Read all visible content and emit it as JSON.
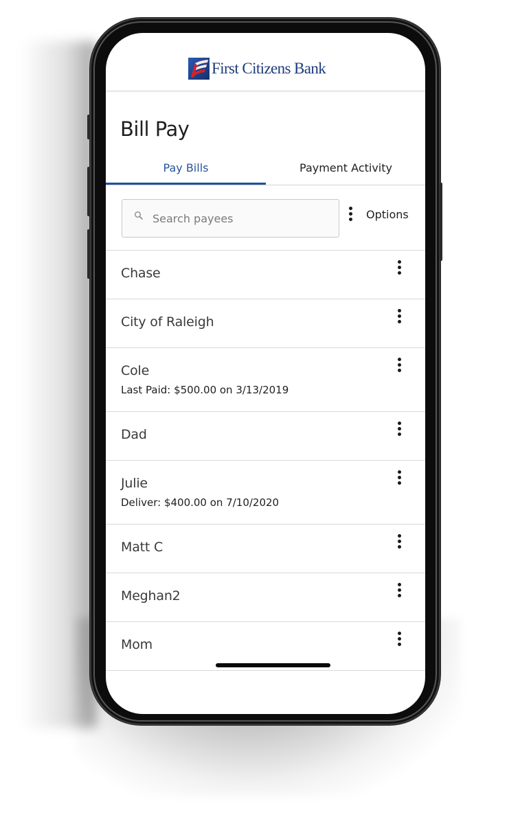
{
  "brand": {
    "name": "First Citizens Bank",
    "primary_color": "#1d3b7a",
    "accent_color": "#d0202b",
    "logo_icon": "flag-logo-icon"
  },
  "page": {
    "title": "Bill Pay"
  },
  "tabs": [
    {
      "label": "Pay Bills",
      "active": true
    },
    {
      "label": "Payment Activity",
      "active": false
    }
  ],
  "search": {
    "placeholder": "Search payees",
    "value": "",
    "icon": "search-icon"
  },
  "options": {
    "label": "Options",
    "icon": "more-vertical-icon"
  },
  "payees": [
    {
      "name": "Chase",
      "detail": null
    },
    {
      "name": "City of Raleigh",
      "detail": null
    },
    {
      "name": "Cole",
      "detail": "Last Paid: $500.00 on 3/13/2019"
    },
    {
      "name": "Dad",
      "detail": null
    },
    {
      "name": "Julie",
      "detail": "Deliver: $400.00 on 7/10/2020"
    },
    {
      "name": "Matt C",
      "detail": null
    },
    {
      "name": "Meghan2",
      "detail": null
    },
    {
      "name": "Mom",
      "detail": null
    }
  ]
}
